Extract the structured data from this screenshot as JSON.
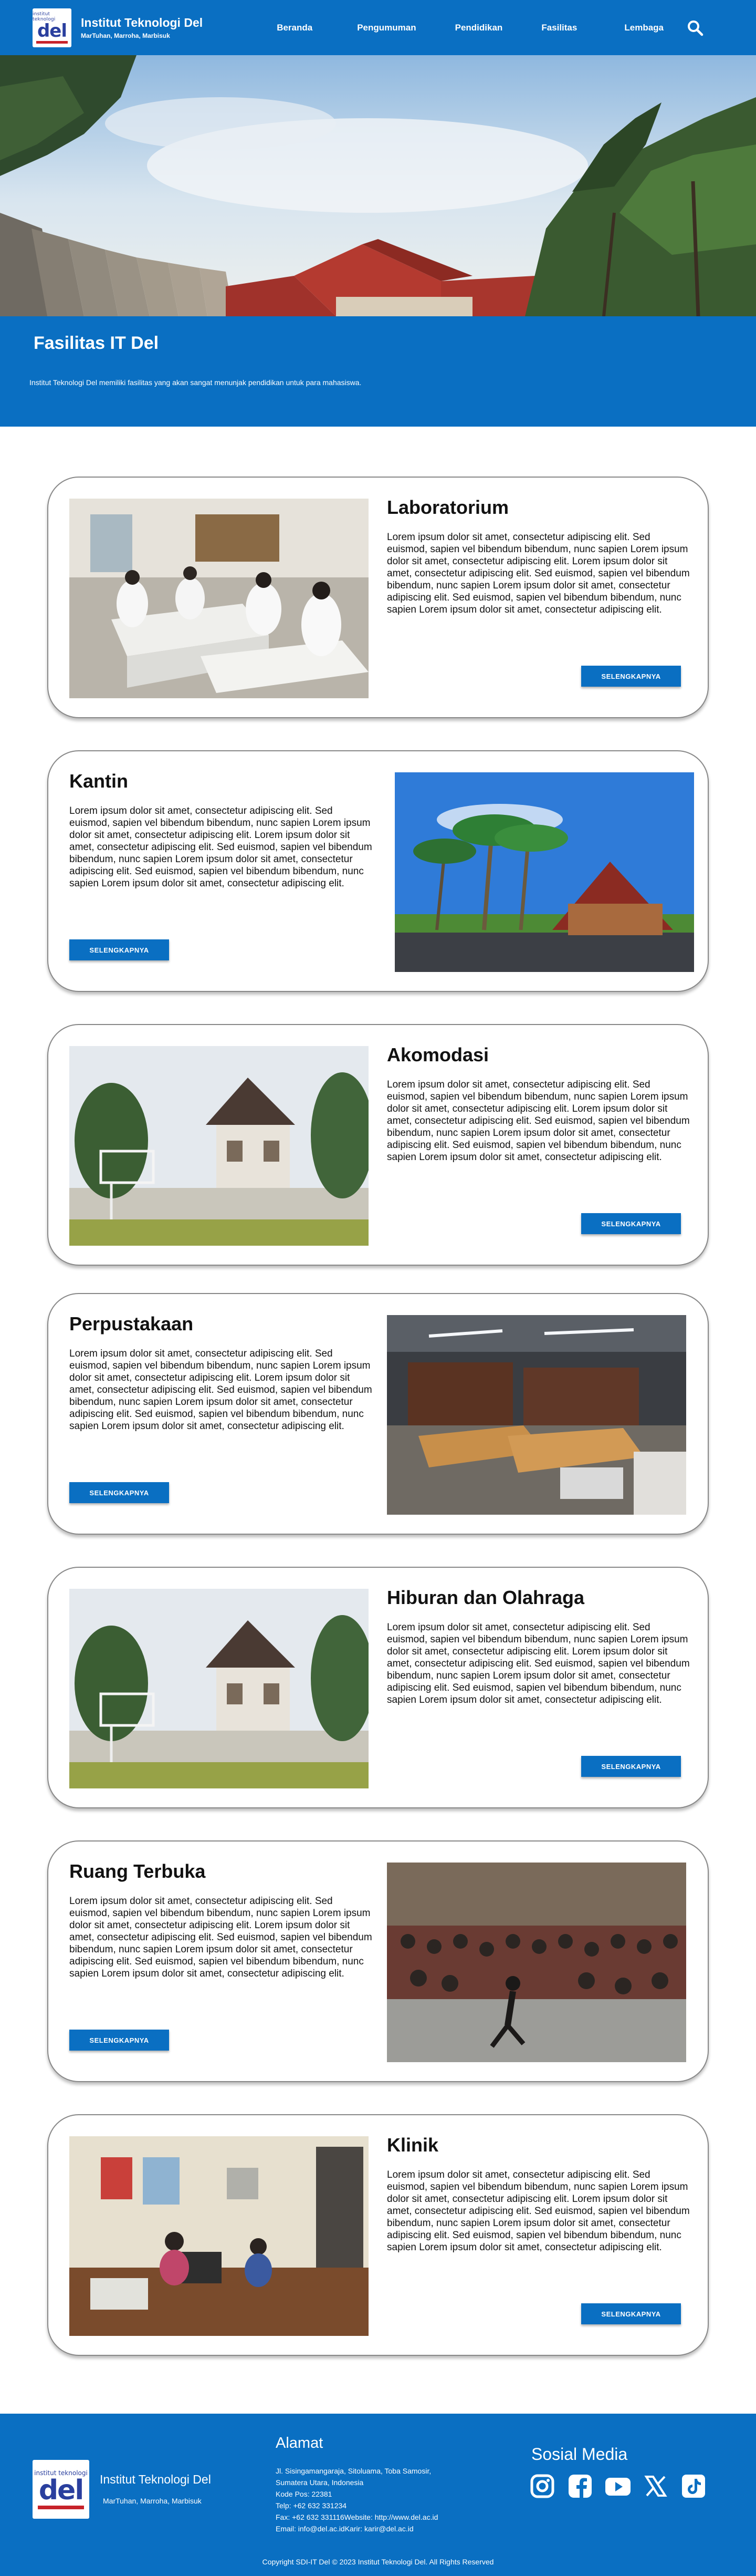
{
  "brand": {
    "logo_top": "institut teknologi",
    "logo_word": "del",
    "title": "Institut Teknologi Del",
    "subtitle": "MarTuhan, Marroha, Marbisuk"
  },
  "nav": {
    "items": [
      "Beranda",
      "Pengumuman",
      "Pendidikan",
      "Fasilitas",
      "Lembaga"
    ],
    "search_icon": "search-icon"
  },
  "page": {
    "title": "Fasilitas IT Del",
    "intro": "Institut Teknologi Del memiliki fasilitas yang akan sangat menunjak pendidikan untuk para mahasiswa."
  },
  "facilities": [
    {
      "title": "Laboratorium",
      "text": "Lorem ipsum dolor sit amet, consectetur adipiscing elit. Sed euismod, sapien vel bibendum bibendum, nunc sapien Lorem ipsum dolor sit amet, consectetur adipiscing elit. Lorem ipsum dolor sit amet, consectetur adipiscing elit. Sed euismod, sapien vel bibendum bibendum, nunc sapien Lorem ipsum dolor sit amet, consectetur adipiscing elit. Sed euismod, sapien vel bibendum bibendum, nunc sapien Lorem ipsum dolor sit amet, consectetur adipiscing elit.",
      "button": "SELENGKAPNYA"
    },
    {
      "title": "Kantin",
      "text": "Lorem ipsum dolor sit amet, consectetur adipiscing elit. Sed euismod, sapien vel bibendum bibendum, nunc sapien Lorem ipsum dolor sit amet, consectetur adipiscing elit. Lorem ipsum dolor sit amet, consectetur adipiscing elit. Sed euismod, sapien vel bibendum bibendum, nunc sapien Lorem ipsum dolor sit amet, consectetur adipiscing elit. Sed euismod, sapien vel bibendum bibendum, nunc sapien Lorem ipsum dolor sit amet, consectetur adipiscing elit.",
      "button": "SELENGKAPNYA"
    },
    {
      "title": "Akomodasi",
      "text": "Lorem ipsum dolor sit amet, consectetur adipiscing elit. Sed euismod, sapien vel bibendum bibendum, nunc sapien Lorem ipsum dolor sit amet, consectetur adipiscing elit. Lorem ipsum dolor sit amet, consectetur adipiscing elit. Sed euismod, sapien vel bibendum bibendum, nunc sapien Lorem ipsum dolor sit amet, consectetur adipiscing elit. Sed euismod, sapien vel bibendum bibendum, nunc sapien Lorem ipsum dolor sit amet, consectetur adipiscing elit.",
      "button": "SELENGKAPNYA"
    },
    {
      "title": "Perpustakaan",
      "text": "Lorem ipsum dolor sit amet, consectetur adipiscing elit. Sed euismod, sapien vel bibendum bibendum, nunc sapien Lorem ipsum dolor sit amet, consectetur adipiscing elit. Lorem ipsum dolor sit amet, consectetur adipiscing elit. Sed euismod, sapien vel bibendum bibendum, nunc sapien Lorem ipsum dolor sit amet, consectetur adipiscing elit. Sed euismod, sapien vel bibendum bibendum, nunc sapien Lorem ipsum dolor sit amet, consectetur adipiscing elit.",
      "button": "SELENGKAPNYA"
    },
    {
      "title": "Hiburan dan Olahraga",
      "text": "Lorem ipsum dolor sit amet, consectetur adipiscing elit. Sed euismod, sapien vel bibendum bibendum, nunc sapien Lorem ipsum dolor sit amet, consectetur adipiscing elit. Lorem ipsum dolor sit amet, consectetur adipiscing elit. Sed euismod, sapien vel bibendum bibendum, nunc sapien Lorem ipsum dolor sit amet, consectetur adipiscing elit. Sed euismod, sapien vel bibendum bibendum, nunc sapien Lorem ipsum dolor sit amet, consectetur adipiscing elit.",
      "button": "SELENGKAPNYA"
    },
    {
      "title": "Ruang Terbuka",
      "text": "Lorem ipsum dolor sit amet, consectetur adipiscing elit. Sed euismod, sapien vel bibendum bibendum, nunc sapien Lorem ipsum dolor sit amet, consectetur adipiscing elit. Lorem ipsum dolor sit amet, consectetur adipiscing elit. Sed euismod, sapien vel bibendum bibendum, nunc sapien Lorem ipsum dolor sit amet, consectetur adipiscing elit. Sed euismod, sapien vel bibendum bibendum, nunc sapien Lorem ipsum dolor sit amet, consectetur adipiscing elit.",
      "button": "SELENGKAPNYA"
    },
    {
      "title": "Klinik",
      "text": "Lorem ipsum dolor sit amet, consectetur adipiscing elit. Sed euismod, sapien vel bibendum bibendum, nunc sapien Lorem ipsum dolor sit amet, consectetur adipiscing elit. Lorem ipsum dolor sit amet, consectetur adipiscing elit. Sed euismod, sapien vel bibendum bibendum, nunc sapien Lorem ipsum dolor sit amet, consectetur adipiscing elit. Sed euismod, sapien vel bibendum bibendum, nunc sapien Lorem ipsum dolor sit amet, consectetur adipiscing elit.",
      "button": "SELENGKAPNYA"
    }
  ],
  "footer": {
    "brand_title": "Institut Teknologi Del",
    "brand_sub": "MarTuhan, Marroha, Marbisuk",
    "address_title": "Alamat",
    "address_lines": [
      "Jl. Sisingamangaraja, Sitoluama, Toba Samosir,",
      "Sumatera Utara, Indonesia",
      "Kode Pos: 22381",
      "Telp: +62 632 331234",
      "Fax: +62 632 331116Website: http://www.del.ac.id",
      "Email: info@del.ac.idKarir: karir@del.ac.id"
    ],
    "social_title": "Sosial Media",
    "social_icons": [
      "instagram-icon",
      "facebook-icon",
      "youtube-icon",
      "x-twitter-icon",
      "tiktok-icon"
    ],
    "copyright": "Copyright SDI-IT Del © 2023 Institut Teknologi Del. All Rights Reserved"
  },
  "colors": {
    "primary": "#0a6fc2",
    "accent_red": "#c7232b",
    "logo_blue": "#2a3f9e"
  }
}
